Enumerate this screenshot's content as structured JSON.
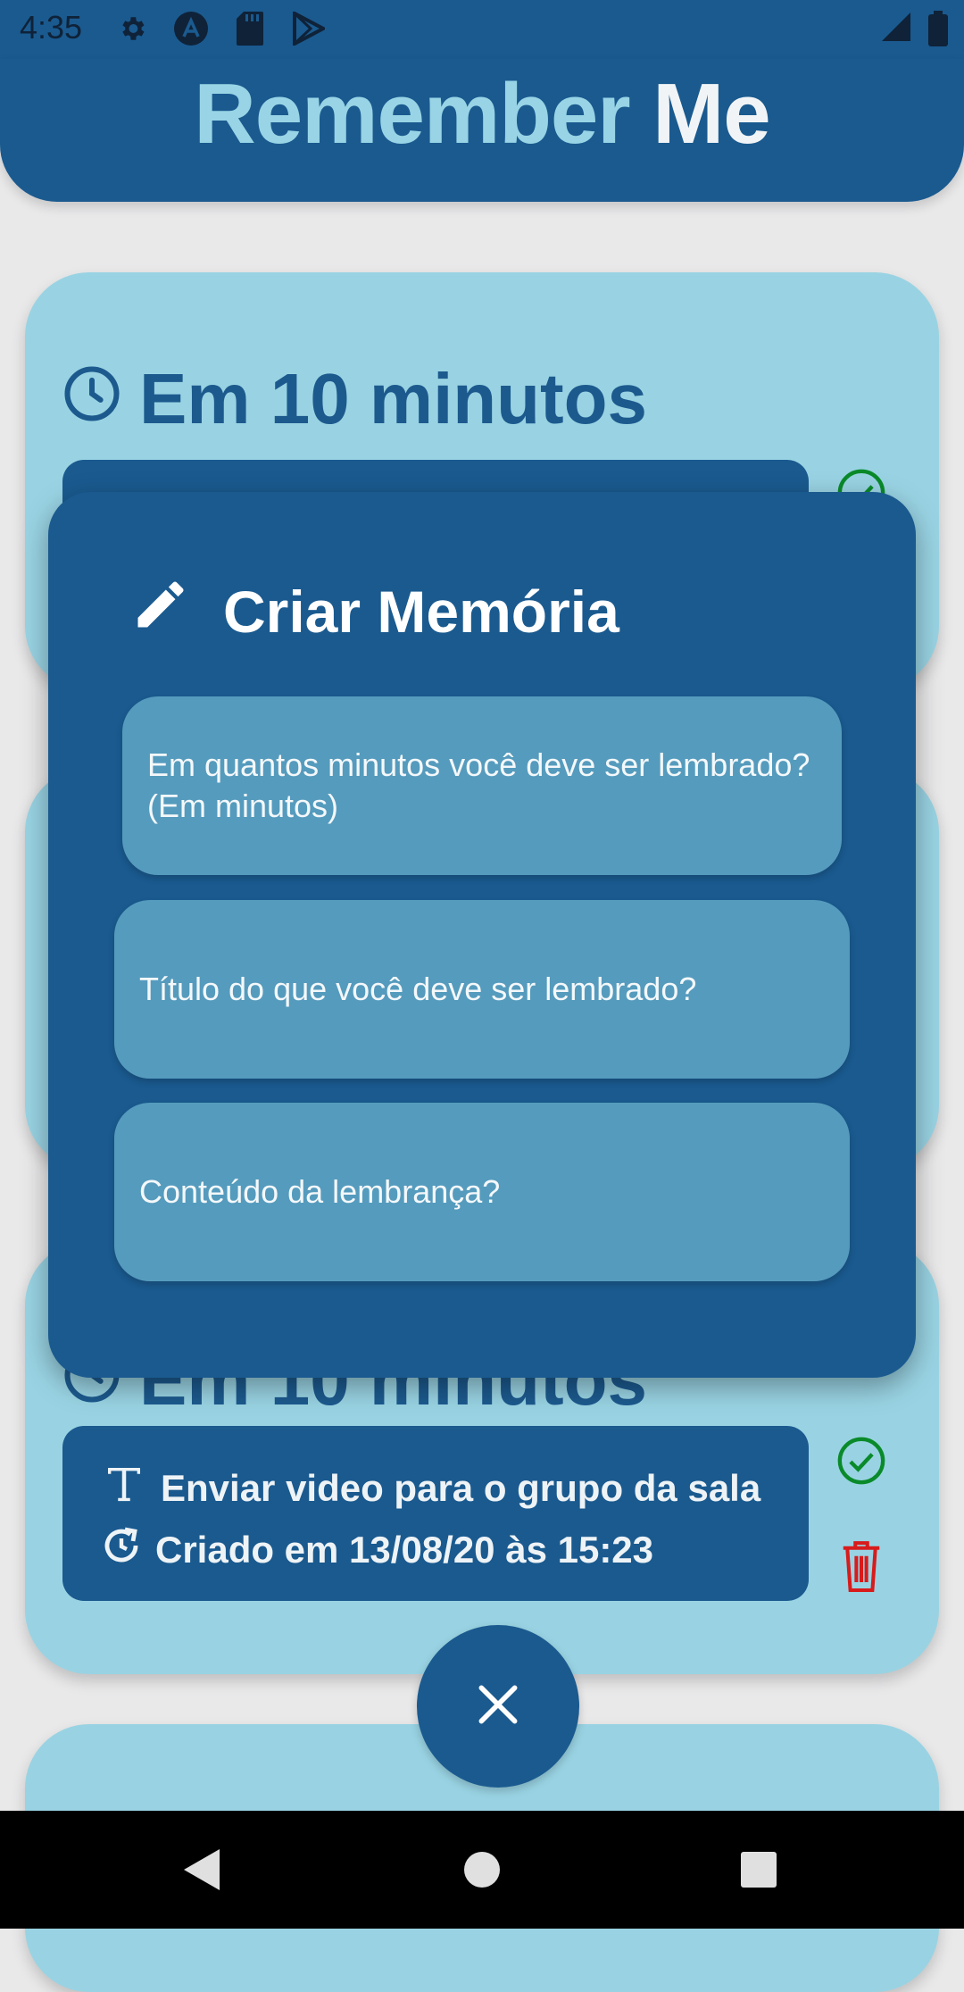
{
  "status_bar": {
    "time": "4:35"
  },
  "app": {
    "title_part1": "Remember",
    "title_part2": "Me"
  },
  "cards": [
    {
      "heading": "Em 10 minutos"
    },
    {
      "heading": "Em 10 minutos",
      "reminder": {
        "title": "Enviar video para o grupo da sala",
        "created": "Criado em 13/08/20 às 15:23"
      }
    }
  ],
  "modal": {
    "title": "Criar Memória",
    "fields": [
      {
        "placeholder": "Em quantos minutos você deve ser lembrado? (Em minutos)"
      },
      {
        "placeholder": "Título do que você deve ser lembrado?"
      },
      {
        "placeholder": "Conteúdo da lembrança?"
      }
    ]
  },
  "colors": {
    "primary": "#1a5a8f",
    "card": "#99d3e3",
    "field": "#559bbd",
    "check": "#0a8a2a",
    "trash": "#d81b1b"
  },
  "icons": [
    "gear-icon",
    "a-logo-icon",
    "sd-card-icon",
    "play-store-icon",
    "signal-icon",
    "battery-icon",
    "clock-icon",
    "pencil-icon",
    "text-icon",
    "history-icon",
    "check-circle-icon",
    "trash-icon",
    "close-icon",
    "back-icon",
    "home-icon",
    "recents-icon"
  ]
}
